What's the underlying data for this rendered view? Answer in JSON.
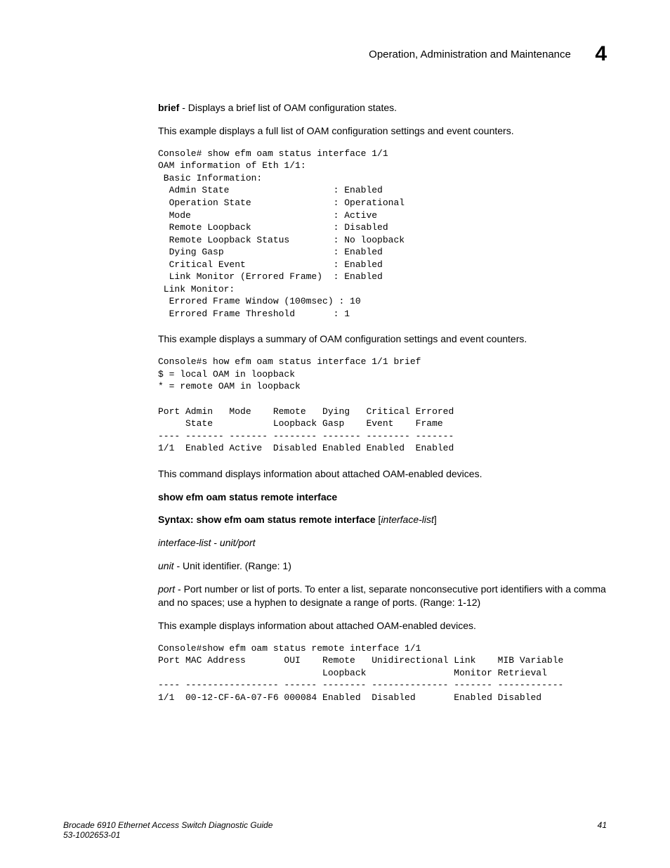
{
  "header": {
    "title": "Operation, Administration and Maintenance",
    "chapter": "4"
  },
  "body": {
    "brief_label": "brief",
    "brief_desc": " - Displays a brief list of OAM configuration states.",
    "p1": "This example displays a full list of OAM configuration settings and event counters.",
    "code1": "Console# show efm oam status interface 1/1\nOAM information of Eth 1/1:\n Basic Information:\n  Admin State                   : Enabled\n  Operation State               : Operational\n  Mode                          : Active\n  Remote Loopback               : Disabled\n  Remote Loopback Status        : No loopback\n  Dying Gasp                    : Enabled\n  Critical Event                : Enabled\n  Link Monitor (Errored Frame)  : Enabled\n Link Monitor:\n  Errored Frame Window (100msec) : 10\n  Errored Frame Threshold       : 1",
    "p2": "This example displays a summary of OAM configuration settings and event counters.",
    "code2": "Console#s how efm oam status interface 1/1 brief\n$ = local OAM in loopback\n* = remote OAM in loopback\n\nPort Admin   Mode    Remote   Dying   Critical Errored\n     State           Loopback Gasp    Event    Frame\n---- ------- ------- -------- ------- -------- -------\n1/1  Enabled Active  Disabled Enabled Enabled  Enabled",
    "p3": "This command displays information about attached OAM-enabled devices.",
    "h1": "show efm oam status remote interface",
    "syntax_prefix": "Syntax:  show efm oam status remote interface",
    "syntax_param": "interface-list",
    "il_def_left": "interface-list",
    "il_def_sep": " - ",
    "il_def_right": "unit/port",
    "unit_label": "unit",
    "unit_desc": " - Unit identifier. (Range: 1)",
    "port_label": "port",
    "port_desc": " - Port number or list of ports. To enter a list, separate nonconsecutive port identifiers with a comma and no spaces; use a hyphen to designate a range of ports. (Range: 1-12)",
    "p4": "This example displays information about attached OAM-enabled devices.",
    "code3": "Console#show efm oam status remote interface 1/1\nPort MAC Address       OUI    Remote   Unidirectional Link    MIB Variable\n                              Loopback                Monitor Retrieval\n---- ----------------- ------ -------- -------------- ------- ------------\n1/1  00-12-CF-6A-07-F6 000084 Enabled  Disabled       Enabled Disabled"
  },
  "footer": {
    "doc": "Brocade 6910 Ethernet Access Switch Diagnostic Guide",
    "pn": "53-1002653-01",
    "page": "41"
  }
}
